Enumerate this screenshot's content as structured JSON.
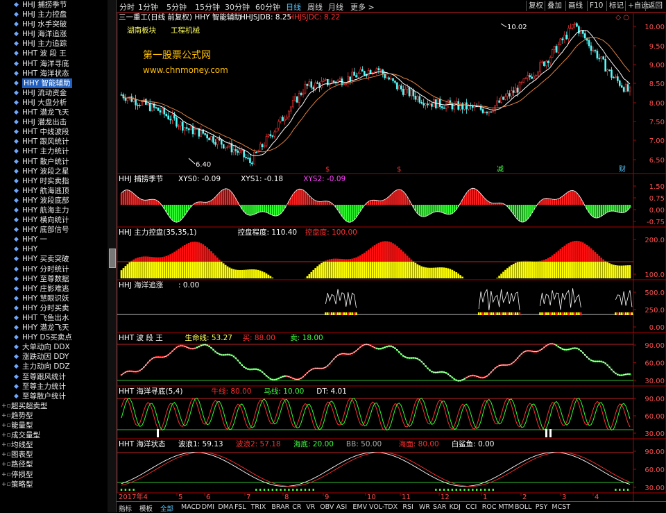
{
  "sidebar": {
    "items": [
      {
        "label": "HHJ 捕捞季节"
      },
      {
        "label": "HHJ 主力控盘"
      },
      {
        "label": "HHJ 水手突破"
      },
      {
        "label": "HHJ 海洋追涨"
      },
      {
        "label": "HHJ 主力追踪"
      },
      {
        "label": "HHT 波 段 王"
      },
      {
        "label": "HHT 海洋寻底"
      },
      {
        "label": "HHT 海洋状态"
      },
      {
        "label": "HHY 智能辅助",
        "selected": true
      },
      {
        "label": "HHJ 流动资金"
      },
      {
        "label": "HHJ 大盘分析"
      },
      {
        "label": "HHT 潜龙飞天"
      },
      {
        "label": "HHJ 潜龙出击"
      },
      {
        "label": "HHT 中线波段"
      },
      {
        "label": "HHT 跟风统计"
      },
      {
        "label": "HHT 主力统计"
      },
      {
        "label": "HHT 散户统计"
      },
      {
        "label": "HHY 波段之星"
      },
      {
        "label": "HHY 时实卖指"
      },
      {
        "label": "HHY 航海逃顶"
      },
      {
        "label": "HHY 波段底部"
      },
      {
        "label": "HHY 航海主力"
      },
      {
        "label": "HHY 横向统计"
      },
      {
        "label": "HHY 底部信号"
      },
      {
        "label": "HHY 一"
      },
      {
        "label": "HHY"
      },
      {
        "label": "HHY 买卖突破"
      },
      {
        "label": "HHY 分时统计"
      },
      {
        "label": "HHY 至尊数据"
      },
      {
        "label": "HHY 庄影难逃"
      },
      {
        "label": "HHY 慧眼识妖"
      },
      {
        "label": "HHY 分时买卖"
      },
      {
        "label": "HHT 飞鱼出水"
      },
      {
        "label": "HHY 潜龙飞天"
      },
      {
        "label": "HHY DS买卖点"
      },
      {
        "label": "大单动向 DDX"
      },
      {
        "label": "涨跌动因 DDY"
      },
      {
        "label": "主力动向 DDZ"
      },
      {
        "label": "至尊跟风统计"
      },
      {
        "label": "至尊主力统计"
      },
      {
        "label": "至尊散户统计"
      }
    ],
    "folders": [
      {
        "label": "超买超卖型"
      },
      {
        "label": "趋势型"
      },
      {
        "label": "能量型"
      },
      {
        "label": "成交量型"
      },
      {
        "label": "均线型"
      },
      {
        "label": "图表型"
      },
      {
        "label": "路径型"
      },
      {
        "label": "停损型"
      },
      {
        "label": "策略型"
      }
    ]
  },
  "topbar": {
    "periods": [
      "分时",
      "1分钟",
      "5分钟",
      "15分钟",
      "30分钟",
      "60分钟",
      "日线",
      "周线",
      "月线",
      "更多 >"
    ],
    "active_period": "日线",
    "buttons": [
      "复权",
      "叠加",
      "画线",
      "F10",
      "标记",
      "+自选",
      "返回"
    ]
  },
  "main_panel": {
    "title": "三一重工(日线 前复权) HHY 智能辅助",
    "hhjsjdb": "HHJSJDB: 8.25",
    "hhjsjdc": "HHJSJDC: 8.22",
    "sector1": "湖南板块",
    "sector2": "工程机械",
    "watermark1": "第一股票公式网",
    "watermark2": "www.chnmoney.com",
    "high_label": "10.02",
    "low_label": "6.40",
    "signals": [
      "$",
      "$",
      "减",
      "财"
    ],
    "axis": [
      "10.00",
      "9.50",
      "9.00",
      "8.50",
      "8.00",
      "7.50",
      "7.00",
      "6.50"
    ]
  },
  "panels": [
    {
      "title": "HHJ 捕捞季节",
      "legend": [
        {
          "text": "XYS0: -0.09",
          "color": "#ffffff"
        },
        {
          "text": "XYS1: -0.18",
          "color": "#ffffff"
        },
        {
          "text": "XYS2: -0.09",
          "color": "#ff44ff"
        }
      ],
      "axis": [
        "1.50",
        "0.75",
        "0.00",
        "-0.75"
      ]
    },
    {
      "title": "HHJ 主力控盘(35,35,1)",
      "legend": [
        {
          "text": "控盘程度: 110.40",
          "color": "#ffffff"
        },
        {
          "text": "控盘度: 100.00",
          "color": "#ff3030"
        }
      ],
      "axis": [
        "200.0",
        "100.0"
      ]
    },
    {
      "title": "HHJ 海洋追涨",
      "legend": [
        {
          "text": ": 0.00",
          "color": "#ffffff"
        }
      ],
      "axis": [
        "500.0",
        "250.0",
        "0.00"
      ]
    },
    {
      "title": "HHT 波 段 王",
      "legend": [
        {
          "text": "生命线: 53.27",
          "color": "#ffff60"
        },
        {
          "text": "买: 88.00",
          "color": "#ff3030"
        },
        {
          "text": "卖: 18.00",
          "color": "#40ff40"
        }
      ],
      "axis": [
        "90.00",
        "60.00",
        "30.00"
      ]
    },
    {
      "title": "HHT 海洋寻底(5,4)",
      "legend": [
        {
          "text": "牛线: 80.00",
          "color": "#ff3030"
        },
        {
          "text": "马线: 10.00",
          "color": "#40ff40"
        },
        {
          "text": "DT: 4.01",
          "color": "#ffffff"
        }
      ],
      "axis": [
        "90.00",
        "60.00",
        "30.00"
      ]
    },
    {
      "title": "HHT 海洋状态",
      "legend": [
        {
          "text": "波浪1: 59.13",
          "color": "#ffffff"
        },
        {
          "text": "波浪2: 57.18",
          "color": "#ff3030"
        },
        {
          "text": "海底: 20.00",
          "color": "#40ff40"
        },
        {
          "text": "BB: 50.00",
          "color": "#aaaaaa"
        },
        {
          "text": "海面: 80.00",
          "color": "#ff3030"
        },
        {
          "text": "白鲨鱼: 0.00",
          "color": "#ffffff"
        }
      ],
      "axis": [
        "90.00",
        "60.00",
        "30.00"
      ]
    }
  ],
  "date_axis": {
    "year": "2017年4",
    "months": [
      "5",
      "6",
      "7",
      "8",
      "9",
      "10",
      "11",
      "12",
      "1",
      "2",
      "3",
      "4"
    ]
  },
  "bottombar": {
    "items": [
      "指标",
      "模板",
      "全部",
      "MACD",
      "DMI",
      "DMA",
      "FSL",
      "TRIX",
      "BRAR",
      "CR",
      "VR",
      "OBV",
      "ASI",
      "EMV",
      "VOL-TDX",
      "RSI",
      "WR",
      "SAR",
      "KDJ",
      "CCI",
      "ROC",
      "MTM",
      "BOLL",
      "PSY",
      "MCST"
    ],
    "active": "全部"
  },
  "colors": {
    "up": "#ff3232",
    "down": "#54fcfc",
    "ma": "#ffffff",
    "axis": "#b00000"
  }
}
